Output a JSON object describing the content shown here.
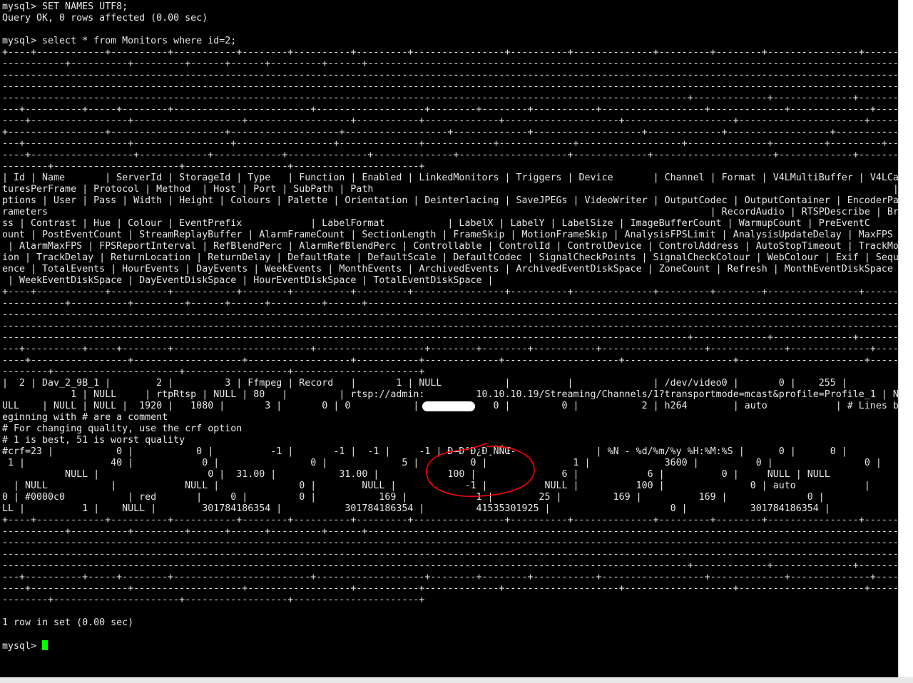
{
  "terminal": {
    "lines": [
      "mysql> SET NAMES UTF8;",
      "Query OK, 0 rows affected (0.00 sec)",
      "",
      "mysql> select * from Monitors where id=2;",
      "+----+------------+----------+-----------+--------+----------+---------+----------------+----------+--------------+---------+--------+----------------+------------",
      "-----------+----------+---------+------+------+---------+------+------------------------------------------------------------------------------------------------",
      "----------------------------------------------------------------------------------------------------------------------------------------------------------------",
      "----------------------------------------------------------------------------------------------------------------------------------------------------------------",
      "------------------------------------------------------------------------------------------------------------------------+-------------+--------------+------------",
      "---+----------+-----+--------+------------------------+-------------------+--------+--------+-----------+------------------+-------------+--------------+-----------",
      "----+-----------------+-------------------+------------------+-----------+-------------+--------------------+-------------------+----------------------+---------",
      "+-----------------+--------------------+-------------------+------------------+-------------+-------------------+-------------+------------------+--------------",
      "---+------------------+-----------------+-----------------+--------------+------------+-------------+------------------+--------------+---------+---------+------",
      "----+------------------+------------+------------+--------------+--------------+-------------------+-------------+---------------------+-------------+-------------",
      "--------+----------------------+------------------+----------------------+",
      "| Id | Name       | ServerId | StorageId | Type   | Function | Enabled | LinkedMonitors | Triggers | Device       | Channel | Format | V4LMultiBuffer | V4LCap",
      "turesPerFrame | Protocol | Method  | Host | Port | SubPath | Path                                                                                           | O",
      "ptions | User | Pass | Width | Height | Colours | Palette | Orientation | Deinterlacing | SaveJPEGs | VideoWriter | OutputCodec | OutputContainer | EncoderPa",
      "rameters                                                                                                                    | RecordAudio | RTSPDescribe | Brightne",
      "ss | Contrast | Hue | Colour | EventPrefix            | LabelFormat           | LabelX | LabelY | LabelSize | ImageBufferCount | WarmupCount | PreEventC",
      "ount | PostEventCount | StreamReplayBuffer | AlarmFrameCount | SectionLength | FrameSkip | MotionFrameSkip | AnalysisFPSLimit | AnalysisUpdateDelay | MaxFPS",
      " | AlarmMaxFPS | FPSReportInterval | RefBlendPerc | AlarmRefBlendPerc | Controllable | ControlId | ControlDevice | ControlAddress | AutoStopTimeout | TrackMot",
      "ion | TrackDelay | ReturnLocation | ReturnDelay | DefaultRate | DefaultScale | DefaultCodec | SignalCheckPoints | SignalCheckColour | WebColour | Exif | Sequ",
      "ence | TotalEvents | HourEvents | DayEvents | WeekEvents | MonthEvents | ArchivedEvents | ArchivedEventDiskSpace | ZoneCount | Refresh | MonthEventDiskSpace",
      " | WeekEventDiskSpace | DayEventDiskSpace | HourEventDiskSpace | TotalEventDiskSpace |",
      "+----+------------+----------+-----------+--------+----------+---------+----------------+----------+--------------+---------+--------+----------------+------------",
      "-----------+----------+---------+------+------+---------+------+------------------------------------------------------------------------------------------------",
      "----------------------------------------------------------------------------------------------------------------------------------------------------------------",
      "----------------------------------------------------------------------------------------------------------------------------------------------------------------",
      "------------------------------------------------------------------------------------------------------------------------+-------------+--------------+------------",
      "---+----------+-----+--------+------------------------+-------------------+--------+--------+-----------+------------------+-------------+--------------+-----------",
      "----+-----------------+-------------------+------------------+-----------+-------------+--------------------+-------------------+----------------------+---------",
      "--------+----------------------+------------------+----------------------+",
      "|  2 | Dav_2_9B_1 |        2 |         3 | Ffmpeg | Record   |       1 | NULL           |          |              | /dev/video0 |       0 |    255 |           NULL |",
      "            1 | NULL     | rtpRtsp | NULL | 80   |         | rtsp://admin:         10.10.10.19/Streaming/Channels/1?transportmode=mcast&profile=Profile_1 | N",
      "ULL    | NULL | NULL |  1920 |   1080 |       3 |       0 | 0           |             0 |         0 |           2 | h264        | auto            | # Lines b",
      "eginning with # are a comment",
      "# For changing quality, use the crf option",
      "# 1 is best, 51 is worst quality",
      "#crf=23 |           0 |           0 |          -1 |       -1 |  -1 |     -1 | Ð—Ð°Ð¿Ð¸ÑÑŒ-              | %N - %d/%m/%y %H:%M:%S |      0 |      0 |",
      " 1 |               40 |            0 |                0 |             5 |         0 |               1 |             3600 |          0 |                0 |",
      "           NULL |                   0 |  31.00 |           31.00 |            100 |               6 |            6 |          0 |     NULL | NULL",
      "  | NULL           |            NULL |              0 |        NULL |            -1 |          NULL |          100 |               0 | auto            |         1",
      "0 | #0000c0           | red       |     0 |         0 |           169 |            1 |        25 |         169 |          169 |              0 |                    NU",
      "LL |          1 |    NULL |        301784186354 |           301784186354 |         41535301925 |                     0 |           301784186354 |",
      "+----+------------+----------+-----------+--------+----------+---------+----------------+----------+--------------+---------+--------+----------------+------------",
      "-----------+----------+---------+------+------+---------+------+------------------------------------------------------------------------------------------------",
      "----------------------------------------------------------------------------------------------------------------------------------------------------------------",
      "----------------------------------------------------------------------------------------------------------------------------------------------------------------",
      "------------------------------------------------------------------------------------------------------------------------+-------------+--------------+------------",
      "---+----------+-----+--------+------------------------+-------------------+--------+--------+-----------+------------------+-------------+--------------+-----------",
      "----+-----------------+-------------------+------------------+-----------+-------------+--------------------+-------------------+----------------------+---------",
      "--------+----------------------+------------------+----------------------+",
      "",
      "1 row in set (0.00 sec)",
      ""
    ],
    "prompt": "mysql> ",
    "cursor_color": "#00ff00"
  },
  "annotation": {
    "shape": "hand-drawn-ellipse",
    "color": "#ff0000"
  },
  "redaction": {
    "color": "#ffffff"
  }
}
